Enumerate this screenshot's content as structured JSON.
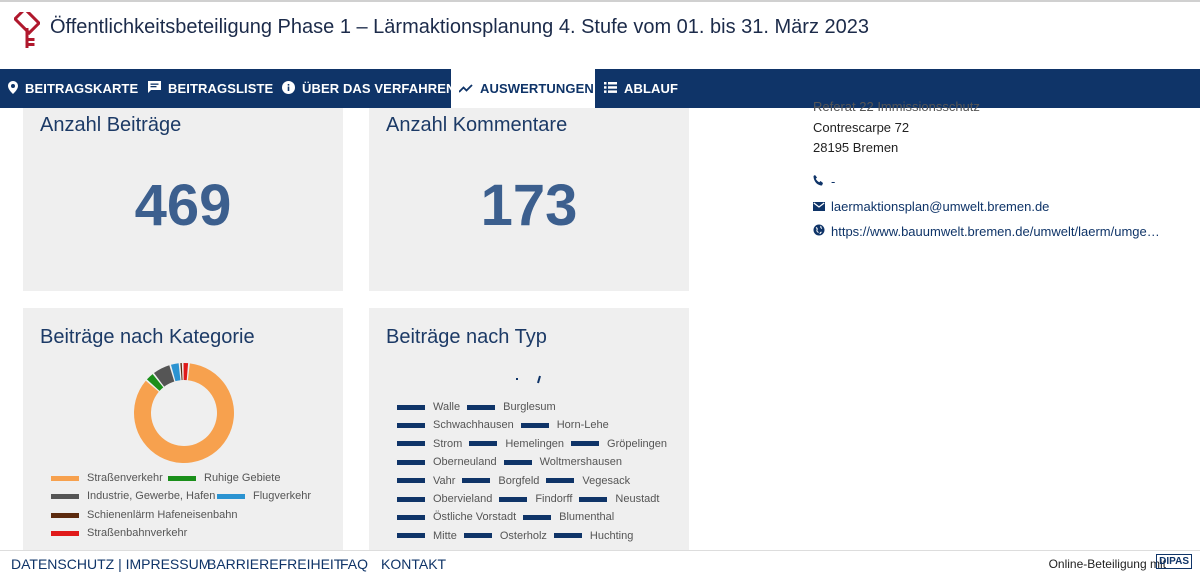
{
  "header": {
    "title": "Öffentlichkeitsbeteiligung Phase 1 – Lärmaktionsplanung 4. Stufe vom 01. bis 31. März 2023"
  },
  "nav": {
    "items": [
      {
        "label": "BEITRAGSKARTE",
        "icon": "location-pin-icon"
      },
      {
        "label": "BEITRAGSLISTE",
        "icon": "comment-icon"
      },
      {
        "label": "ÜBER DAS VERFAHREN",
        "icon": "info-icon"
      },
      {
        "label": "AUSWERTUNGEN",
        "icon": "trending-icon",
        "active": true
      },
      {
        "label": "ABLAUF",
        "icon": "list-icon"
      }
    ]
  },
  "cards": {
    "beitraege": {
      "title": "Anzahl Beiträge",
      "value": "469"
    },
    "kommentare": {
      "title": "Anzahl Kommentare",
      "value": "173"
    },
    "kategorie": {
      "title": "Beiträge nach Kategorie"
    },
    "typ": {
      "title": "Beiträge nach Typ"
    }
  },
  "chart_data": {
    "type": "pie",
    "title": "Beiträge nach Kategorie",
    "legend": [
      {
        "name": "Straßenverkehr",
        "color": "#f7a14e"
      },
      {
        "name": "Ruhige Gebiete",
        "color": "#1a8f1a"
      },
      {
        "name": "Industrie, Gewerbe, Hafen",
        "color": "#555555"
      },
      {
        "name": "Flugverkehr",
        "color": "#2b93d1"
      },
      {
        "name": "Schienenlärm Hafeneisenbahn",
        "color": "#5c2a0e"
      },
      {
        "name": "Straßenbahnverkehr",
        "color": "#e01a1a"
      }
    ],
    "values": [
      84,
      3,
      6,
      3,
      1,
      2
    ]
  },
  "typ_legend": [
    [
      "Walle",
      "Burglesum"
    ],
    [
      "Schwachhausen",
      "Horn-Lehe"
    ],
    [
      "Strom",
      "Hemelingen",
      "Gröpelingen"
    ],
    [
      "Oberneuland",
      "Woltmershausen"
    ],
    [
      "Vahr",
      "Borgfeld",
      "Vegesack"
    ],
    [
      "Obervieland",
      "Findorff",
      "Neustadt"
    ],
    [
      "Östliche Vorstadt",
      "Blumenthal"
    ],
    [
      "Mitte",
      "Osterholz",
      "Huchting"
    ]
  ],
  "contact": {
    "partial": "Referat 22 Immissionsschutz",
    "street": "Contrescarpe 72",
    "city": "28195 Bremen",
    "phone": "-",
    "email": "laermaktionsplan@umwelt.bremen.de",
    "website": "https://www.bauumwelt.bremen.de/umwelt/laerm/umge…"
  },
  "footer": {
    "datenschutz": "DATENSCHUTZ | IMPRESSUM",
    "barrierefreiheit": "BARRIEREFREIHEIT",
    "faq": "FAQ",
    "kontakt": "KONTAKT",
    "online": "Online-Beteiligung mit",
    "brand": "DIPAS"
  }
}
